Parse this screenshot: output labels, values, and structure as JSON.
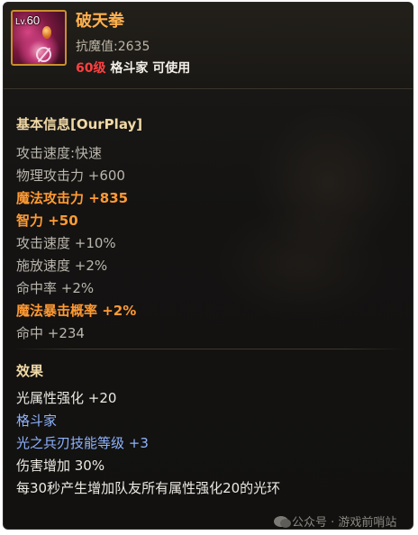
{
  "item": {
    "level_badge_prefix": "Lv.",
    "level_badge_value": "60",
    "name": "破天拳",
    "resistance": "抗魔值:2635",
    "requirement_level": "60级",
    "requirement_text": "格斗家 可使用"
  },
  "basic_info": {
    "title": "基本信息[OurPlay]",
    "lines": [
      {
        "text": "攻击速度:快速",
        "style": "grey"
      },
      {
        "text": "物理攻击力 +600",
        "style": "grey"
      },
      {
        "text": "魔法攻击力 +835",
        "style": "orange"
      },
      {
        "text": "智力 +50",
        "style": "orange"
      },
      {
        "text": "攻击速度 +10%",
        "style": "grey"
      },
      {
        "text": "施放速度 +2%",
        "style": "grey"
      },
      {
        "text": "命中率 +2%",
        "style": "grey"
      },
      {
        "text": "魔法暴击概率 +2%",
        "style": "orange"
      },
      {
        "text": "命中 +234",
        "style": "grey"
      }
    ]
  },
  "effects": {
    "title": "效果",
    "lines": [
      {
        "text": "光属性强化 +20",
        "style": "white"
      },
      {
        "text": "格斗家",
        "style": "blue"
      },
      {
        "text": "光之兵刃技能等级 +3",
        "style": "blue"
      },
      {
        "text": "伤害增加 30%",
        "style": "white"
      },
      {
        "text": "每30秒产生增加队友所有属性强化20的光环",
        "style": "white"
      }
    ]
  },
  "watermark": {
    "text": "公众号 · 游戏前哨站"
  },
  "colors": {
    "name": "#ffb14d",
    "highlight_orange": "#ff9a33",
    "requirement_red": "#ff4040",
    "class_blue": "#8fb4ff",
    "frame_gold": "#c8902d"
  }
}
